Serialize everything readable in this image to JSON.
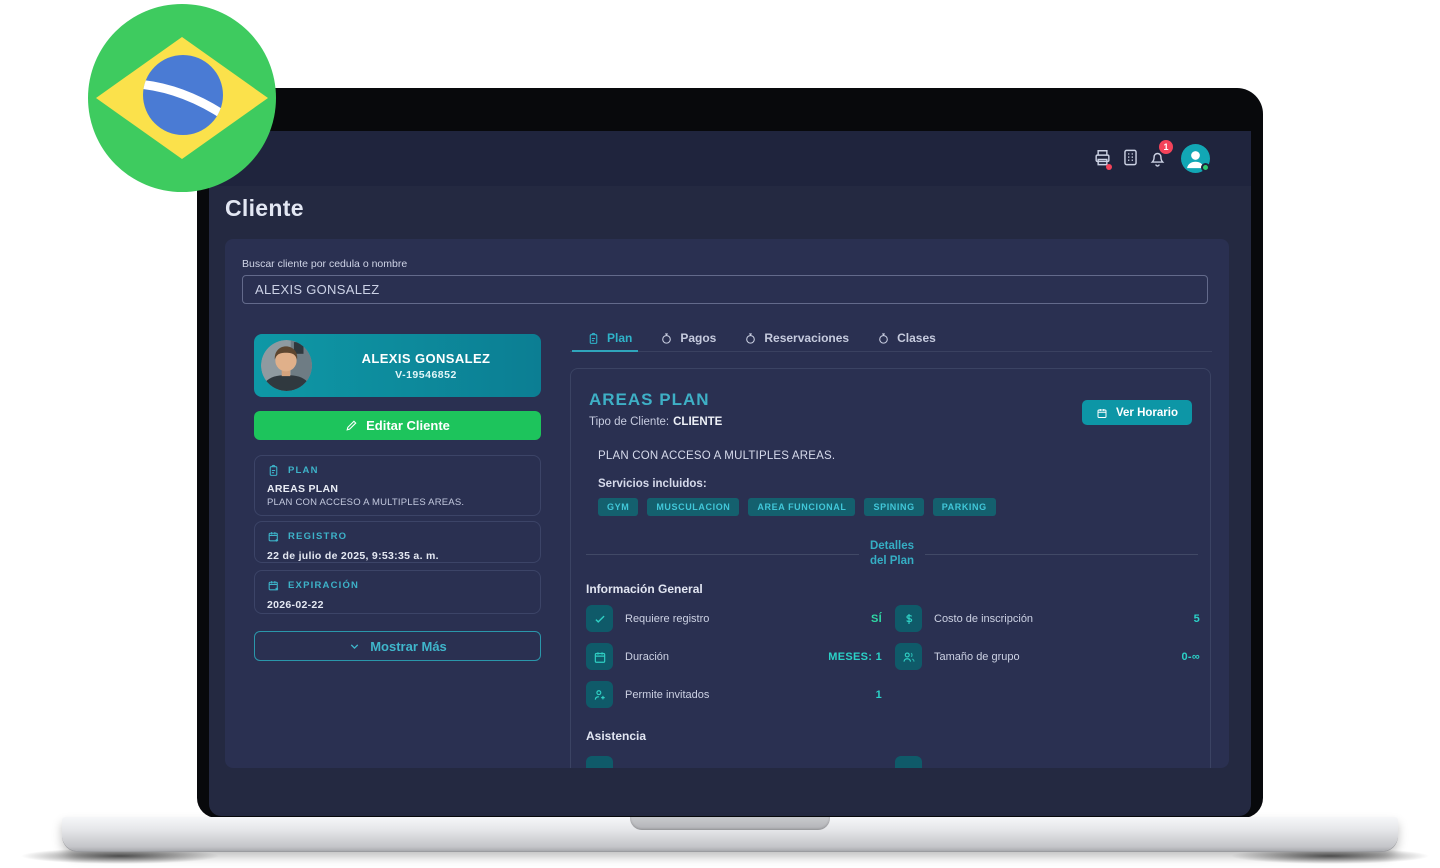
{
  "badge": {
    "name": "brazil-flag"
  },
  "topbar": {
    "notification_count": "1"
  },
  "page": {
    "title": "Cliente"
  },
  "search": {
    "label": "Buscar cliente por cedula o nombre",
    "value": "ALEXIS GONSALEZ"
  },
  "client": {
    "name": "ALEXIS GONSALEZ",
    "id": "V-19546852",
    "edit_button": "Editar Cliente"
  },
  "summary_cards": [
    {
      "icon": "clipboard-icon",
      "label": "PLAN",
      "title": "AREAS PLAN",
      "description": "PLAN CON ACCESO A MULTIPLES AREAS."
    },
    {
      "icon": "calendar-plus-icon",
      "label": "REGISTRO",
      "value": "22 de julio de 2025, 9:53:35 a. m."
    },
    {
      "icon": "calendar-x-icon",
      "label": "EXPIRACIÓN",
      "value": "2026-02-22"
    }
  ],
  "show_more_button": "Mostrar Más",
  "tabs": [
    {
      "label": "Plan",
      "active": true
    },
    {
      "label": "Pagos",
      "active": false
    },
    {
      "label": "Reservaciones",
      "active": false
    },
    {
      "label": "Clases",
      "active": false
    }
  ],
  "plan_panel": {
    "title": "AREAS PLAN",
    "client_type_label": "Tipo de Cliente:",
    "client_type_value": "CLIENTE",
    "schedule_button": "Ver Horario",
    "description": "PLAN CON ACCESO A MULTIPLES AREAS.",
    "services_label": "Servicios incluidos:",
    "services": [
      "GYM",
      "MUSCULACION",
      "AREA FUNCIONAL",
      "SPINING",
      "PARKING"
    ],
    "divider_label": "Detalles del Plan",
    "sections": {
      "general": "Información General",
      "attendance": "Asistencia"
    },
    "general_rows": [
      {
        "icon": "check-icon",
        "label": "Requiere registro",
        "value": "SÍ"
      },
      {
        "icon": "dollar-icon",
        "label": "Costo de inscripción",
        "value": "5"
      },
      {
        "icon": "calendar-icon",
        "label": "Duración",
        "value": "MESES: 1"
      },
      {
        "icon": "users-icon",
        "label": "Tamaño de grupo",
        "value": "0-∞"
      },
      {
        "icon": "user-plus-icon",
        "label": "Permite invitados",
        "value": "1"
      }
    ]
  },
  "colors": {
    "accent_teal": "#3db3c9",
    "value_teal": "#2bd1c7",
    "success_green": "#1dc45c",
    "client_card_teal": "#0d93a2",
    "alert_red": "#f4435a"
  }
}
